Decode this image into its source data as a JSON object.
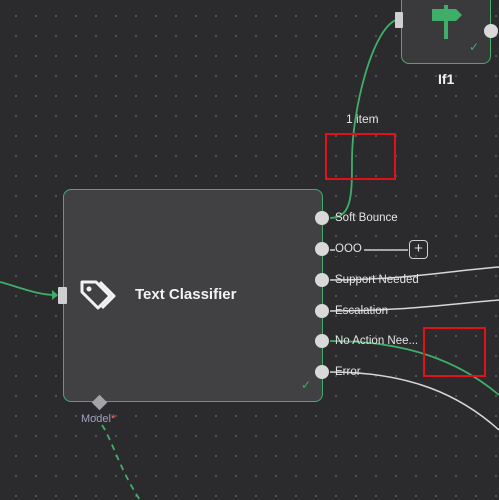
{
  "nodes": {
    "text_classifier": {
      "title": "Text Classifier",
      "icon": "tags-icon",
      "outputs": [
        "Soft Bounce",
        "OOO",
        "Support Needed",
        "Escalation",
        "No Action Nee...",
        "Error"
      ],
      "input_label": "Model",
      "required_marker": "*"
    },
    "if1": {
      "title": "If1",
      "icon": "signpost-icon"
    }
  },
  "edge_label": "1 item",
  "add_button": "+",
  "colors": {
    "canvas_bg": "#2b2b2d",
    "node_bg": "#414143",
    "node_border": "#3fae6a",
    "edge_success": "#3fae6a",
    "edge_default": "#d6d6d6",
    "marker": "#e3101a"
  }
}
